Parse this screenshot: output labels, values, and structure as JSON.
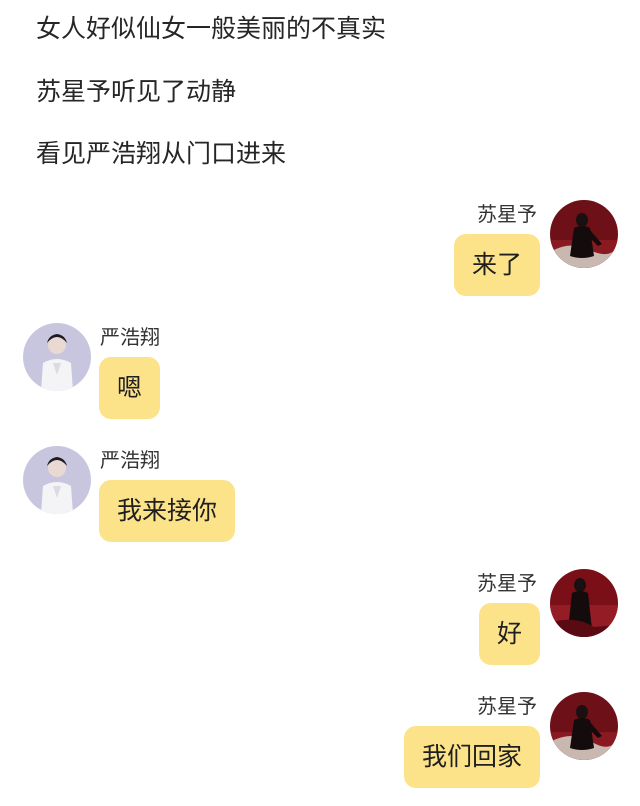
{
  "narration": [
    "女人好似仙女一般美丽的不真实",
    "苏星予听见了动静",
    "看见严浩翔从门口进来"
  ],
  "messages": [
    {
      "sender": "苏星予",
      "text": "来了",
      "side": "right",
      "avatar_icon": "woman-red-dress-avatar-icon"
    },
    {
      "sender": "严浩翔",
      "text": "嗯",
      "side": "left",
      "avatar_icon": "man-white-suit-avatar-icon"
    },
    {
      "sender": "严浩翔",
      "text": "我来接你",
      "side": "left",
      "avatar_icon": "man-white-suit-avatar-icon"
    },
    {
      "sender": "苏星予",
      "text": "好",
      "side": "right",
      "avatar_icon": "woman-red-dress-avatar-icon"
    },
    {
      "sender": "苏星予",
      "text": "我们回家",
      "side": "right",
      "avatar_icon": "woman-red-dress-avatar-icon"
    }
  ],
  "colors": {
    "bubble": "#fce38a",
    "background": "#ffffff",
    "text": "#222222"
  }
}
